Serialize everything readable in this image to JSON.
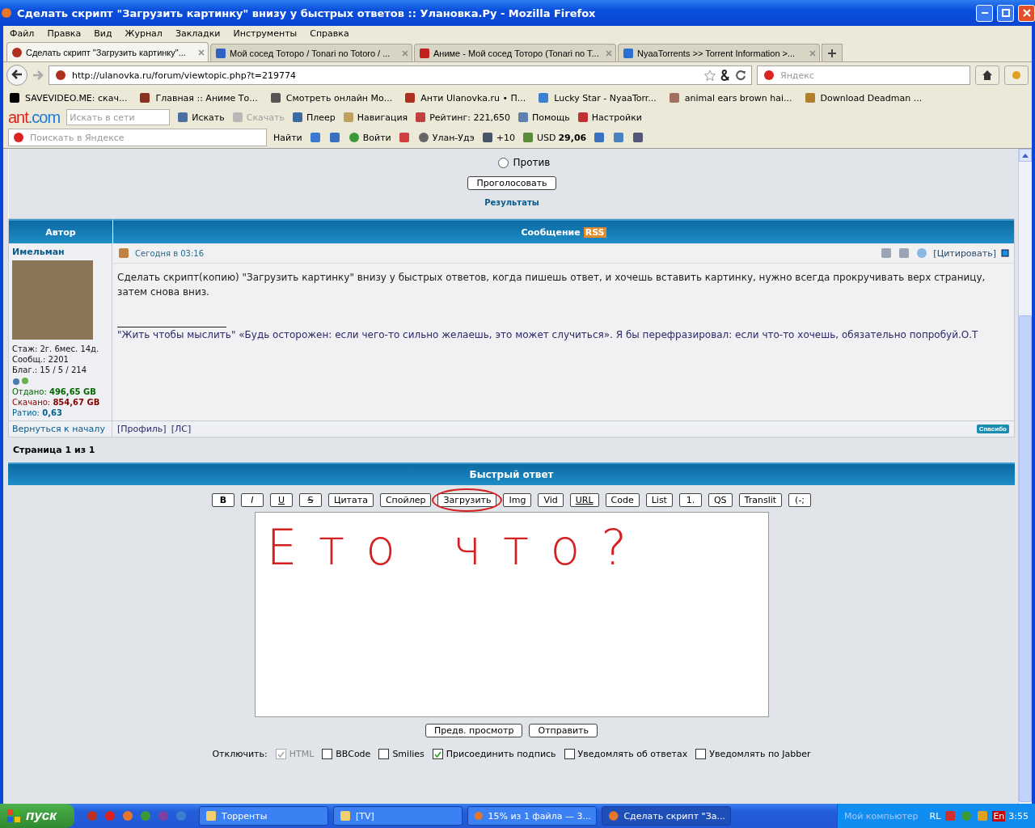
{
  "window": {
    "title": "Сделать скрипт \"Загрузить картинку\" внизу у быстрых ответов :: Улановка.Ру - Mozilla Firefox"
  },
  "menu": [
    "Файл",
    "Правка",
    "Вид",
    "Журнал",
    "Закладки",
    "Инструменты",
    "Справка"
  ],
  "tabs": [
    {
      "label": "Сделать скрипт \"Загрузить картинку\"...",
      "selected": true
    },
    {
      "label": "Мой сосед Тоторо / Tonari no Totoro / ...",
      "selected": false
    },
    {
      "label": "Аниме - Мой сосед Тоторо (Tonari no T...",
      "selected": false
    },
    {
      "label": "NyaaTorrents >> Torrent Information >...",
      "selected": false
    }
  ],
  "nav": {
    "url": "http://ulanovka.ru/forum/viewtopic.php?t=219774",
    "search_placeholder": "Яндекс"
  },
  "bookmarks": [
    "SAVEVIDEO.ME: скач...",
    "Главная :: Аниме То...",
    "Смотреть онлайн Мо...",
    "Анти Ulanovka.ru • П...",
    "Lucky Star - NyaaTorr...",
    "animal ears brown hai...",
    "Download Deadman ..."
  ],
  "ant_toolbar": {
    "logo_parts": [
      "ant",
      ".com"
    ],
    "search_placeholder": "Искать в сети",
    "items": [
      {
        "label": "Искать",
        "disabled": false
      },
      {
        "label": "Скачать",
        "disabled": true
      },
      {
        "label": "Плеер",
        "disabled": false
      },
      {
        "label": "Навигация",
        "disabled": false
      },
      {
        "label": "Рейтинг: 221,650",
        "disabled": false
      },
      {
        "label": "Помощь",
        "disabled": false
      },
      {
        "label": "Настройки",
        "disabled": false
      }
    ]
  },
  "yandex_bar": {
    "search_placeholder": "Поискать в Яндексе",
    "find": "Найти",
    "login": "Войти",
    "city": "Улан-Удэ",
    "temperature": "+10",
    "currency": "USD",
    "rate": "29,06"
  },
  "poll": {
    "option": {
      "label": "Против",
      "selected": false
    },
    "vote": "Проголосовать",
    "results": "Результаты"
  },
  "post_table": {
    "col_author": "Автор",
    "col_message": "Сообщение",
    "rss": "RSS",
    "author": "Имельман",
    "date": "Сегодня в 03:16",
    "quote": "[Цитировать]",
    "stats": [
      "Стаж: 2г. 6мес. 14д.",
      "Сообщ.: 2201",
      "Благ.: 15 / 5 / 214"
    ],
    "transfer": [
      {
        "label": "Отдано:",
        "value": "496,65 GB",
        "color": "#006600"
      },
      {
        "label": "Скачано:",
        "value": "854,67 GB",
        "color": "#880000"
      },
      {
        "label": "Ратио:",
        "value": "0,63",
        "color": "#005f8f"
      }
    ],
    "body": "Сделать скрипт(копию) \"Загрузить картинку\" внизу у быстрых ответов, когда пишешь ответ, и хочешь вставить картинку, нужно всегда прокручивать верх страницу, затем снова вниз.",
    "signature": "\"Жить чтобы мыслить\" «Будь осторожен: если чего-то сильно желаешь, это может случиться». Я бы перефразировал: если что-то хочешь, обязательно попробуй.О.Т",
    "back_to_top": "Вернуться к началу",
    "profile": "[Профиль]",
    "pm": "[ЛС]",
    "thanks": "Спасибо"
  },
  "pagination": "Страница 1 из 1",
  "quick_reply": {
    "title": "Быстрый ответ",
    "format_buttons": [
      {
        "label": "B",
        "kind": "bold",
        "circled": false
      },
      {
        "label": "I",
        "kind": "italic",
        "circled": false
      },
      {
        "label": "U",
        "kind": "underline",
        "circled": false
      },
      {
        "label": "S",
        "kind": "strike",
        "circled": false
      },
      {
        "label": "Цитата",
        "kind": "plain",
        "circled": false
      },
      {
        "label": "Спойлер",
        "kind": "plain",
        "circled": false
      },
      {
        "label": "Загрузить",
        "kind": "plain",
        "circled": true
      },
      {
        "label": "Img",
        "kind": "plain",
        "circled": false
      },
      {
        "label": "Vid",
        "kind": "plain",
        "circled": false
      },
      {
        "label": "URL",
        "kind": "underline",
        "circled": false
      },
      {
        "label": "Code",
        "kind": "plain",
        "circled": false
      },
      {
        "label": "List",
        "kind": "plain",
        "circled": false
      },
      {
        "label": "1.",
        "kind": "plain",
        "circled": false
      },
      {
        "label": "QS",
        "kind": "plain",
        "circled": false
      },
      {
        "label": "Translit",
        "kind": "plain",
        "circled": false
      },
      {
        "label": "(-;",
        "kind": "plain",
        "circled": false
      }
    ],
    "scribble": "Ето что?",
    "buttons": [
      "Предв. просмотр",
      "Отправить"
    ],
    "options_label": "Отключить:",
    "options": [
      {
        "label": "HTML",
        "checked": true,
        "disabled": true
      },
      {
        "label": "BBCode",
        "checked": false,
        "disabled": false
      },
      {
        "label": "Smilies",
        "checked": false,
        "disabled": false
      },
      {
        "label": "Присоединить подпись",
        "checked": true,
        "disabled": false
      },
      {
        "label": "Уведомлять об ответах",
        "checked": false,
        "disabled": false
      },
      {
        "label": "Уведомлять по Jabber",
        "checked": false,
        "disabled": false
      }
    ]
  },
  "taskbar": {
    "start": "пуск",
    "tasks": [
      {
        "label": "Торренты",
        "selected": false
      },
      {
        "label": "[TV]",
        "selected": false
      },
      {
        "label": "15% из 1 файла — 3...",
        "selected": false
      },
      {
        "label": "Сделать скрипт \"За...",
        "selected": true
      }
    ],
    "computer": "Мой компьютер",
    "layout": "RL",
    "lang": "En",
    "time": "3:55"
  }
}
